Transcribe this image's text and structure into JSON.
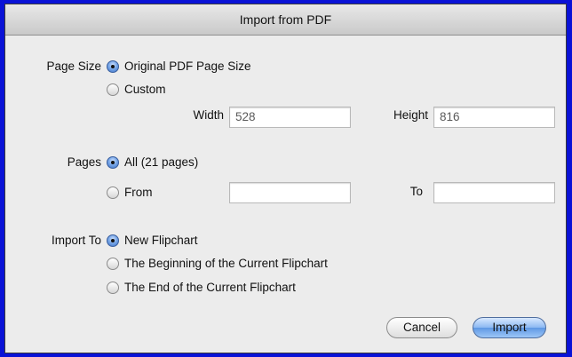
{
  "dialog": {
    "title": "Import from PDF",
    "page_size": {
      "label": "Page Size",
      "options": [
        "Original PDF Page Size",
        "Custom"
      ],
      "selected": "Original PDF Page Size",
      "width_label": "Width",
      "width_value": "528",
      "height_label": "Height",
      "height_value": "816"
    },
    "pages": {
      "label": "Pages",
      "options": [
        "All (21 pages)",
        "From"
      ],
      "selected": "All (21 pages)",
      "from_value": "",
      "to_label": "To",
      "to_value": ""
    },
    "import_to": {
      "label": "Import To",
      "options": [
        "New Flipchart",
        "The Beginning of the Current Flipchart",
        "The End of the Current Flipchart"
      ],
      "selected": "New Flipchart"
    },
    "buttons": {
      "cancel": "Cancel",
      "import": "Import"
    }
  },
  "colors": {
    "background": "#0a12d6",
    "default_button": "#6ea3ea"
  }
}
